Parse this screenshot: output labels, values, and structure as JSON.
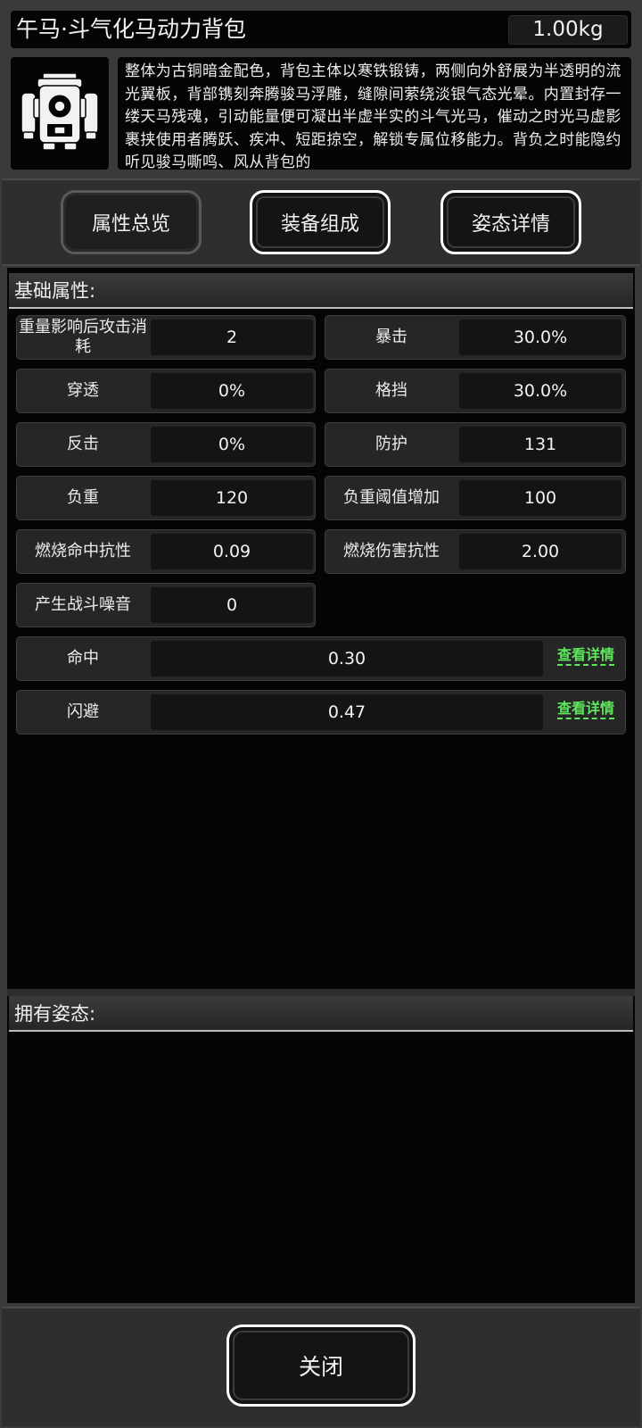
{
  "header": {
    "title": "午马·斗气化马动力背包",
    "weight": "1.00kg",
    "item_icon": "backpack-icon",
    "description": "整体为古铜暗金配色，背包主体以寒铁锻铸，两侧向外舒展为半透明的流光翼板，背部镌刻奔腾骏马浮雕，缝隙间萦绕淡银气态光晕。内置封存一缕天马残魂，引动能量便可凝出半虚半实的斗气光马，催动之时光马虚影裹挟使用者腾跃、疾冲、短距掠空，解锁专属位移能力。背负之时能隐约听见骏马嘶鸣、风从背包的"
  },
  "tabs": [
    {
      "label": "属性总览"
    },
    {
      "label": "装备组成"
    },
    {
      "label": "姿态详情"
    }
  ],
  "basic": {
    "heading": "基础属性:",
    "attrs": [
      {
        "name": "重量影响后攻击消耗",
        "value": "2"
      },
      {
        "name": "暴击",
        "value": "30.0%"
      },
      {
        "name": "穿透",
        "value": "0%"
      },
      {
        "name": "格挡",
        "value": "30.0%"
      },
      {
        "name": "反击",
        "value": "0%"
      },
      {
        "name": "防护",
        "value": "131"
      },
      {
        "name": "负重",
        "value": "120"
      },
      {
        "name": "负重阈值增加",
        "value": "100"
      },
      {
        "name": "燃烧命中抗性",
        "value": "0.09"
      },
      {
        "name": "燃烧伤害抗性",
        "value": "2.00"
      },
      {
        "name": "产生战斗噪音",
        "value": "0"
      }
    ],
    "wide": [
      {
        "name": "命中",
        "value": "0.30",
        "link": "查看详情"
      },
      {
        "name": "闪避",
        "value": "0.47",
        "link": "查看详情"
      }
    ]
  },
  "stances": {
    "heading": "拥有姿态:"
  },
  "footer": {
    "close_label": "关闭"
  },
  "colors": {
    "link": "#5ee85e",
    "panel": "#050505",
    "frame": "#2e2e2e"
  }
}
